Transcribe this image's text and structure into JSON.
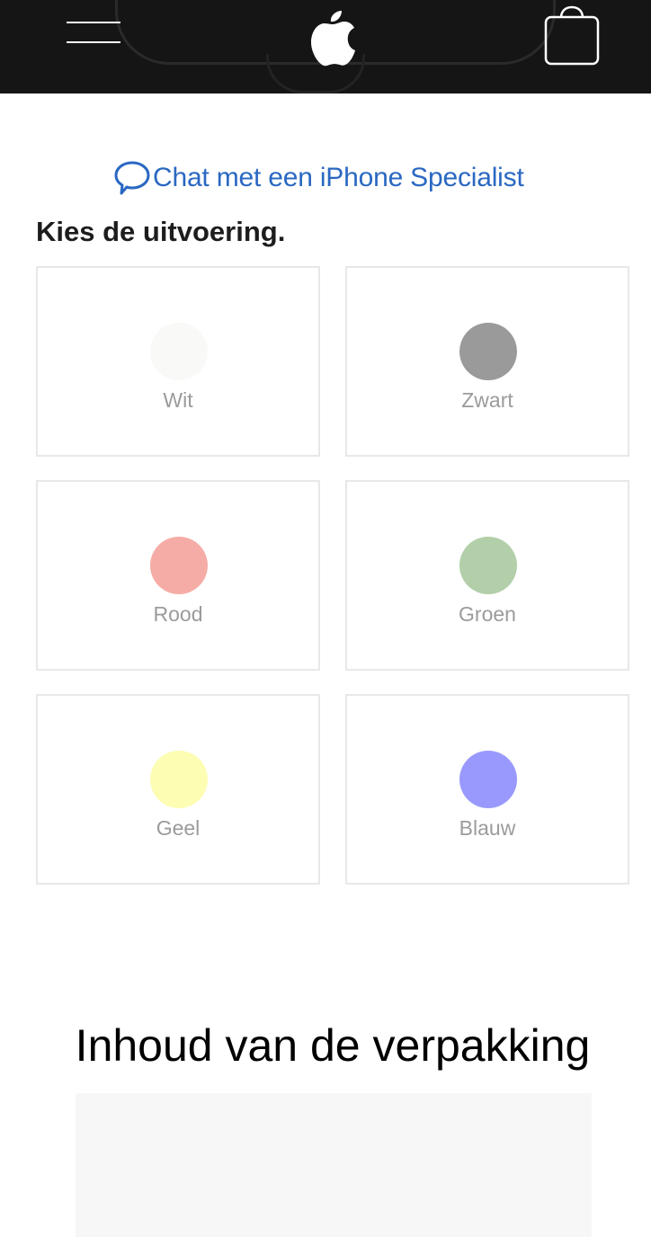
{
  "header": {
    "menu_icon": "hamburger-menu-icon",
    "logo_icon": "apple-logo-icon",
    "bag_icon": "shopping-bag-icon",
    "background": "#151515"
  },
  "chat": {
    "icon": "chat-bubble-icon",
    "label": "Chat met een iPhone Specialist",
    "color": "#2a68c2"
  },
  "finish": {
    "title": "Kies de uitvoering.",
    "options": [
      {
        "name": "Wit",
        "color": "#f9f9f8"
      },
      {
        "name": "Zwart",
        "color": "#9a9a9a"
      },
      {
        "name": "Rood",
        "color": "#f6aca6"
      },
      {
        "name": "Groen",
        "color": "#b2cfa9"
      },
      {
        "name": "Geel",
        "color": "#fdfdb3"
      },
      {
        "name": "Blauw",
        "color": "#9999fd"
      }
    ]
  },
  "box_contents": {
    "title": "Inhoud van de verpakking"
  }
}
